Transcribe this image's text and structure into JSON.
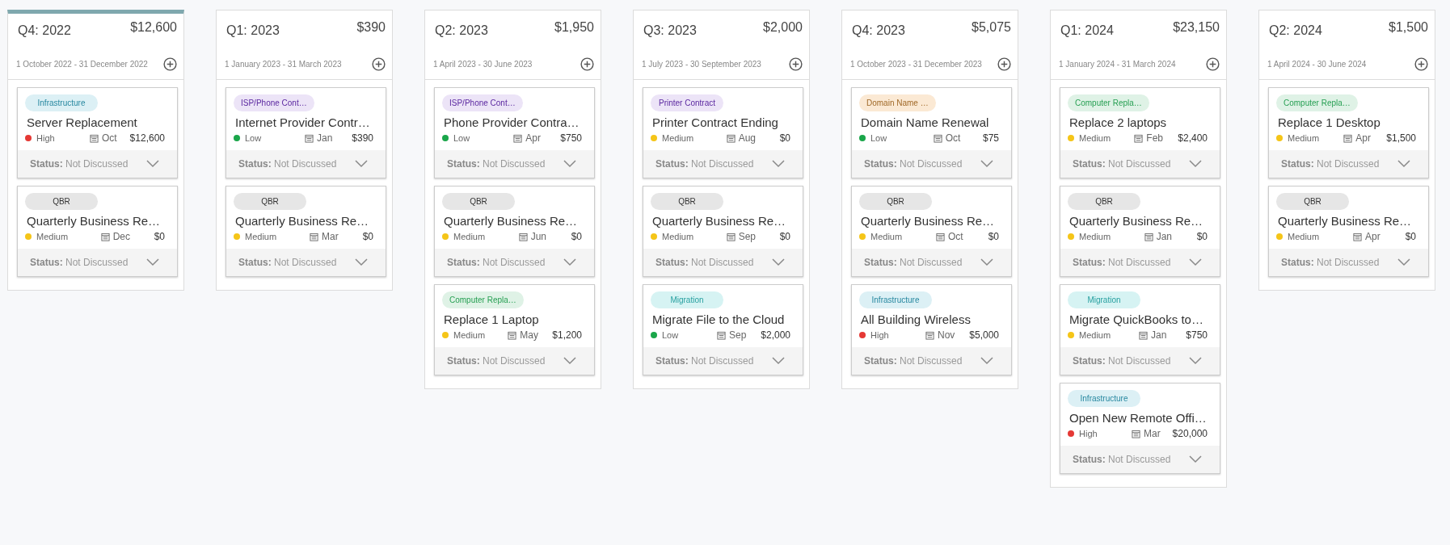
{
  "columns": [
    {
      "title": "Q4: 2022",
      "total": "$12,600",
      "range": "1 October 2022 - 31 December 2022",
      "selected": true,
      "cards": [
        {
          "tag": {
            "label": "Infrastructure",
            "color": "#dcf0f5"
          },
          "title": "Server Replacement",
          "priority": {
            "label": "High",
            "color": "#e53935"
          },
          "month": "Oct",
          "amount": "$12,600",
          "status_label": "Status:",
          "status": "Not Discussed"
        },
        {
          "tag": {
            "label": "QBR",
            "color": "#e6e6e6"
          },
          "title": "Quarterly Business Re…",
          "priority": {
            "label": "Medium",
            "color": "#f5c518"
          },
          "month": "Dec",
          "amount": "$0",
          "status_label": "Status:",
          "status": "Not Discussed"
        }
      ]
    },
    {
      "title": "Q1: 2023",
      "total": "$390",
      "range": "1 January 2023 - 31 March 2023",
      "selected": false,
      "cards": [
        {
          "tag": {
            "label": "ISP/Phone Cont…",
            "color": "#ece4f7"
          },
          "title": "Internet Provider Contr…",
          "priority": {
            "label": "Low",
            "color": "#1aa64a"
          },
          "month": "Jan",
          "amount": "$390",
          "status_label": "Status:",
          "status": "Not Discussed"
        },
        {
          "tag": {
            "label": "QBR",
            "color": "#e6e6e6"
          },
          "title": "Quarterly Business Re…",
          "priority": {
            "label": "Medium",
            "color": "#f5c518"
          },
          "month": "Mar",
          "amount": "$0",
          "status_label": "Status:",
          "status": "Not Discussed"
        }
      ]
    },
    {
      "title": "Q2: 2023",
      "total": "$1,950",
      "range": "1 April 2023 - 30 June 2023",
      "selected": false,
      "cards": [
        {
          "tag": {
            "label": "ISP/Phone Cont…",
            "color": "#ece4f7"
          },
          "title": "Phone Provider Contra…",
          "priority": {
            "label": "Low",
            "color": "#1aa64a"
          },
          "month": "Apr",
          "amount": "$750",
          "status_label": "Status:",
          "status": "Not Discussed"
        },
        {
          "tag": {
            "label": "QBR",
            "color": "#e6e6e6"
          },
          "title": "Quarterly Business Re…",
          "priority": {
            "label": "Medium",
            "color": "#f5c518"
          },
          "month": "Jun",
          "amount": "$0",
          "status_label": "Status:",
          "status": "Not Discussed"
        },
        {
          "tag": {
            "label": "Computer Repla…",
            "color": "#dff2e6"
          },
          "title": "Replace 1 Laptop",
          "priority": {
            "label": "Medium",
            "color": "#f5c518"
          },
          "month": "May",
          "amount": "$1,200",
          "status_label": "Status:",
          "status": "Not Discussed"
        }
      ]
    },
    {
      "title": "Q3: 2023",
      "total": "$2,000",
      "range": "1 July 2023 - 30 September 2023",
      "selected": false,
      "cards": [
        {
          "tag": {
            "label": "Printer Contract",
            "color": "#ece4f7"
          },
          "title": "Printer Contract Ending",
          "priority": {
            "label": "Medium",
            "color": "#f5c518"
          },
          "month": "Aug",
          "amount": "$0",
          "status_label": "Status:",
          "status": "Not Discussed"
        },
        {
          "tag": {
            "label": "QBR",
            "color": "#e6e6e6"
          },
          "title": "Quarterly Business Re…",
          "priority": {
            "label": "Medium",
            "color": "#f5c518"
          },
          "month": "Sep",
          "amount": "$0",
          "status_label": "Status:",
          "status": "Not Discussed"
        },
        {
          "tag": {
            "label": "Migration",
            "color": "#d6f3f3"
          },
          "title": "Migrate File to the Cloud",
          "priority": {
            "label": "Low",
            "color": "#1aa64a"
          },
          "month": "Sep",
          "amount": "$2,000",
          "status_label": "Status:",
          "status": "Not Discussed"
        }
      ]
    },
    {
      "title": "Q4: 2023",
      "total": "$5,075",
      "range": "1 October 2023 - 31 December 2023",
      "selected": false,
      "cards": [
        {
          "tag": {
            "label": "Domain Name …",
            "color": "#fbe9d4"
          },
          "title": "Domain Name Renewal",
          "priority": {
            "label": "Low",
            "color": "#1aa64a"
          },
          "month": "Oct",
          "amount": "$75",
          "status_label": "Status:",
          "status": "Not Discussed"
        },
        {
          "tag": {
            "label": "QBR",
            "color": "#e6e6e6"
          },
          "title": "Quarterly Business Re…",
          "priority": {
            "label": "Medium",
            "color": "#f5c518"
          },
          "month": "Oct",
          "amount": "$0",
          "status_label": "Status:",
          "status": "Not Discussed"
        },
        {
          "tag": {
            "label": "Infrastructure",
            "color": "#dcf0f5"
          },
          "title": "All Building Wireless",
          "priority": {
            "label": "High",
            "color": "#e53935"
          },
          "month": "Nov",
          "amount": "$5,000",
          "status_label": "Status:",
          "status": "Not Discussed"
        }
      ]
    },
    {
      "title": "Q1: 2024",
      "total": "$23,150",
      "range": "1 January 2024 - 31 March 2024",
      "selected": false,
      "cards": [
        {
          "tag": {
            "label": "Computer Repla…",
            "color": "#dff2e6"
          },
          "title": "Replace 2 laptops",
          "priority": {
            "label": "Medium",
            "color": "#f5c518"
          },
          "month": "Feb",
          "amount": "$2,400",
          "status_label": "Status:",
          "status": "Not Discussed"
        },
        {
          "tag": {
            "label": "QBR",
            "color": "#e6e6e6"
          },
          "title": "Quarterly Business Re…",
          "priority": {
            "label": "Medium",
            "color": "#f5c518"
          },
          "month": "Jan",
          "amount": "$0",
          "status_label": "Status:",
          "status": "Not Discussed"
        },
        {
          "tag": {
            "label": "Migration",
            "color": "#d6f3f3"
          },
          "title": "Migrate QuickBooks to…",
          "priority": {
            "label": "Medium",
            "color": "#f5c518"
          },
          "month": "Jan",
          "amount": "$750",
          "status_label": "Status:",
          "status": "Not Discussed"
        },
        {
          "tag": {
            "label": "Infrastructure",
            "color": "#dcf0f5"
          },
          "title": "Open New Remote Offi…",
          "priority": {
            "label": "High",
            "color": "#e53935"
          },
          "month": "Mar",
          "amount": "$20,000",
          "status_label": "Status:",
          "status": "Not Discussed"
        }
      ]
    },
    {
      "title": "Q2: 2024",
      "total": "$1,500",
      "range": "1 April 2024 - 30 June 2024",
      "selected": false,
      "cards": [
        {
          "tag": {
            "label": "Computer Repla…",
            "color": "#dff2e6"
          },
          "title": "Replace 1 Desktop",
          "priority": {
            "label": "Medium",
            "color": "#f5c518"
          },
          "month": "Apr",
          "amount": "$1,500",
          "status_label": "Status:",
          "status": "Not Discussed"
        },
        {
          "tag": {
            "label": "QBR",
            "color": "#e6e6e6"
          },
          "title": "Quarterly Business Re…",
          "priority": {
            "label": "Medium",
            "color": "#f5c518"
          },
          "month": "Apr",
          "amount": "$0",
          "status_label": "Status:",
          "status": "Not Discussed"
        }
      ]
    }
  ]
}
